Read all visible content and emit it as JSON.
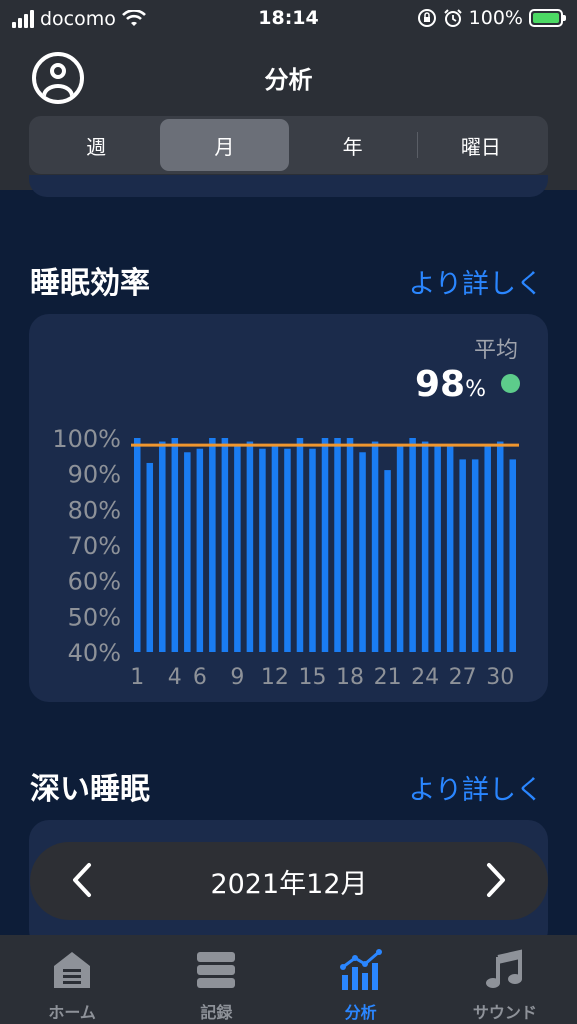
{
  "status_bar": {
    "carrier": "docomo",
    "time": "18:14",
    "battery": "100%"
  },
  "header": {
    "title": "分析",
    "segments": [
      "週",
      "月",
      "年",
      "曜日"
    ],
    "selected_segment": "月"
  },
  "sleep_efficiency": {
    "title": "睡眠効率",
    "more_link": "より詳しく",
    "average_label": "平均",
    "average_value": "98",
    "average_unit": "%",
    "status_color": "#5dcc8b"
  },
  "deep_sleep": {
    "title": "深い睡眠",
    "more_link": "より詳しく"
  },
  "month_picker": {
    "label": "2021年12月"
  },
  "tabbar": {
    "items": [
      {
        "label": "ホーム",
        "icon": "home-icon",
        "active": false
      },
      {
        "label": "記録",
        "icon": "records-icon",
        "active": false
      },
      {
        "label": "分析",
        "icon": "analysis-icon",
        "active": true
      },
      {
        "label": "サウンド",
        "icon": "music-note-icon",
        "active": false
      }
    ]
  },
  "chart_data": {
    "type": "bar",
    "title": "",
    "xlabel": "",
    "ylabel": "",
    "ylim": [
      40,
      100
    ],
    "y_ticks": [
      "40%",
      "50%",
      "60%",
      "70%",
      "80%",
      "90%",
      "100%"
    ],
    "x_tick_labels": [
      "1",
      "4",
      "6",
      "9",
      "12",
      "15",
      "18",
      "21",
      "24",
      "27",
      "30"
    ],
    "categories": [
      1,
      2,
      3,
      4,
      5,
      6,
      7,
      8,
      9,
      10,
      11,
      12,
      13,
      14,
      15,
      16,
      17,
      18,
      19,
      20,
      21,
      22,
      23,
      24,
      25,
      26,
      27,
      28,
      29,
      30,
      31
    ],
    "values": [
      100,
      93,
      99,
      100,
      96,
      97,
      100,
      100,
      98,
      99,
      97,
      98,
      97,
      100,
      97,
      100,
      100,
      100,
      96,
      99,
      91,
      98,
      100,
      99,
      98,
      98,
      94,
      94,
      98,
      99,
      94
    ],
    "average_line": 98,
    "bar_color": "#1a7cf2",
    "average_line_color": "#f0962e",
    "grid": false
  }
}
